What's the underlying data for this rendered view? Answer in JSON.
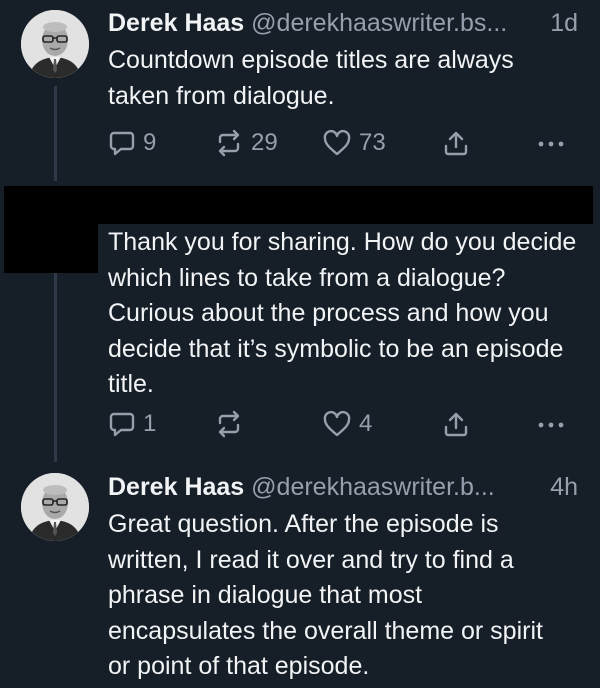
{
  "posts": [
    {
      "author": "Derek Haas",
      "handle": "@derekhaaswriter.bs...",
      "time": "1d",
      "text": "Countdown episode titles are always taken from dialogue.",
      "replies": "9",
      "reposts": "29",
      "likes": "73"
    },
    {
      "author": "",
      "handle": "",
      "time": "",
      "text": "Thank you for sharing. How do you decide which lines to take from a dialogue? Curious about the process and how you decide that it’s symbolic to be an episode title.",
      "replies": "1",
      "reposts": "",
      "likes": "4"
    },
    {
      "author": "Derek Haas",
      "handle": "@derekhaaswriter.b...",
      "time": "4h",
      "text": "Great question.  After the episode is written, I read it over and try to find a phrase in dialogue that most encapsulates the overall theme or spirit or point of that episode."
    }
  ],
  "icons": {
    "reply": "speech-bubble-icon",
    "repost": "repost-arrows-icon",
    "like": "heart-outline-icon",
    "share": "share-upload-icon",
    "more": "more-dots-icon"
  },
  "colors": {
    "background": "#161e27",
    "text": "#f1f3f5",
    "muted": "#95a0ad",
    "thread_line": "#2f3a48",
    "redaction": "#000000"
  }
}
